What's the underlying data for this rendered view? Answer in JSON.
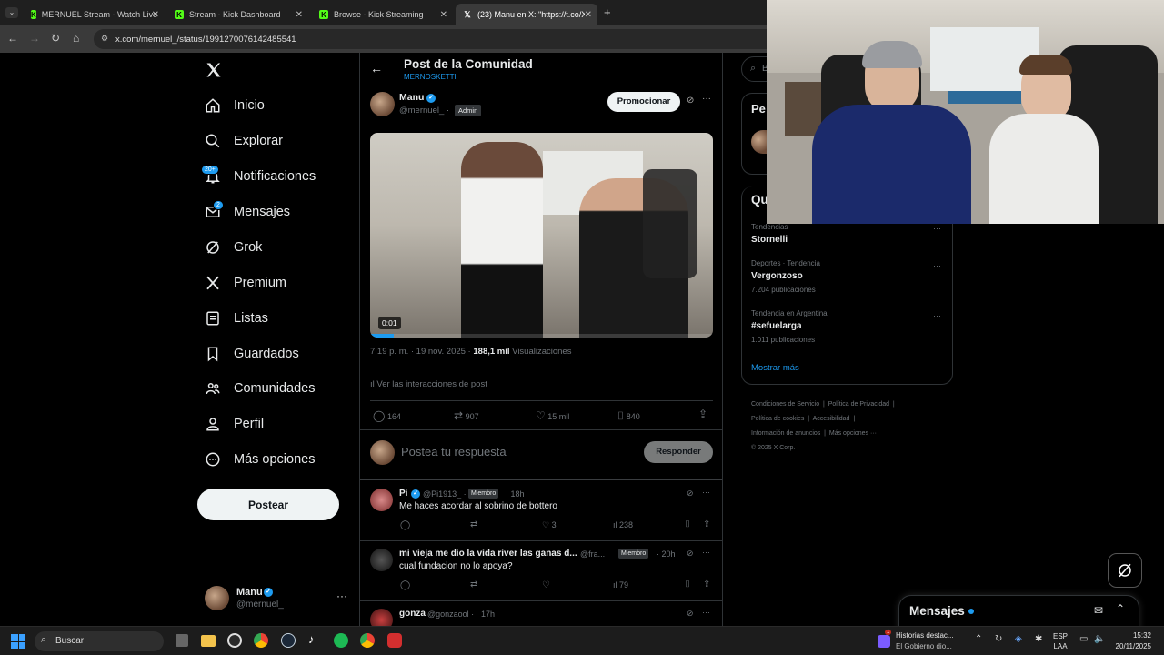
{
  "browser": {
    "tabs": [
      {
        "label": "MERNUEL Stream - Watch Live",
        "favicon": "kick-icon"
      },
      {
        "label": "Stream - Kick Dashboard",
        "favicon": "kick-icon"
      },
      {
        "label": "Browse - Kick Streaming",
        "favicon": "kick-icon"
      },
      {
        "label": "(23) Manu en X: \"https://t.co/X",
        "favicon": "x-icon"
      }
    ],
    "url": "x.com/mernuel_/status/1991270076142485541"
  },
  "nav": {
    "items": [
      {
        "label": "Inicio"
      },
      {
        "label": "Explorar"
      },
      {
        "label": "Notificaciones",
        "badge": "20+"
      },
      {
        "label": "Mensajes",
        "badge": "2"
      },
      {
        "label": "Grok"
      },
      {
        "label": "Premium"
      },
      {
        "label": "Listas"
      },
      {
        "label": "Guardados"
      },
      {
        "label": "Comunidades"
      },
      {
        "label": "Perfil"
      },
      {
        "label": "Más opciones"
      }
    ],
    "post_button": "Postear",
    "account": {
      "name": "Manu",
      "handle": "@mernuel_"
    }
  },
  "post": {
    "header_title": "Post de la Comunidad",
    "community": "MERNOSKETTI",
    "author": "Manu",
    "handle": "@mernuel_ ·",
    "role": "Admin",
    "promote": "Promocionar",
    "video_time": "0:01",
    "video_progress": 0.07,
    "timestamp": "7:19 p. m. · 19 nov. 2025 ·",
    "views": "188,1 mil",
    "views_label": "Visualizaciones",
    "interactions": "Ver las interacciones de post",
    "stats": {
      "replies": "164",
      "reposts": "907",
      "likes": "15 mil",
      "bookmarks": "840"
    },
    "reply_placeholder": "Postea tu respuesta",
    "reply_button": "Responder"
  },
  "replies": [
    {
      "name": "Pi",
      "handle": "@Pi1913_ ·",
      "role": "Miembro",
      "time": "· 18h",
      "text": "Me haces acordar al sobrino de bottero",
      "replies": "",
      "reposts": "",
      "likes": "3",
      "views": "238"
    },
    {
      "name": "mi vieja me dio la vida river las ganas d...",
      "handle": "@fra...",
      "role": "Miembro",
      "time": "· 20h",
      "text": "cual fundacion no lo apoya?",
      "replies": "",
      "reposts": "",
      "likes": "",
      "views": "79"
    },
    {
      "name": "gonza",
      "handle": "@gonzaool ·",
      "role": "",
      "time": "17h",
      "text": "",
      "replies": "",
      "reposts": "",
      "likes": "",
      "views": ""
    }
  ],
  "right": {
    "search_fragment": "B",
    "box1_fragment": "Pe",
    "box2_fragment": "Qu",
    "trends": [
      {
        "context": "Tendencias",
        "name": "Stornelli",
        "count": ""
      },
      {
        "context": "Deportes · Tendencia",
        "name": "Vergonzoso",
        "count": "7.204 publicaciones"
      },
      {
        "context": "Tendencia en Argentina",
        "name": "#sefuelarga",
        "count": "1.011 publicaciones"
      }
    ],
    "show_more": "Mostrar más",
    "footer": [
      "Condiciones de Servicio",
      "Política de Privacidad",
      "Política de cookies",
      "Accesibilidad",
      "Información de anuncios",
      "Más opciones ···",
      "© 2025 X Corp."
    ]
  },
  "messages_drawer": {
    "title": "Mensajes"
  },
  "taskbar": {
    "search": "Buscar",
    "news_title": "Historias destac...",
    "news_sub": "El Gobierno dio...",
    "news_badge": "1",
    "lang1": "ESP",
    "lang2": "LAA",
    "time": "15:32",
    "date": "20/11/2025"
  },
  "colors": {
    "accent": "#1d9bf0",
    "kick": "#53fc18",
    "bg": "#000000"
  }
}
